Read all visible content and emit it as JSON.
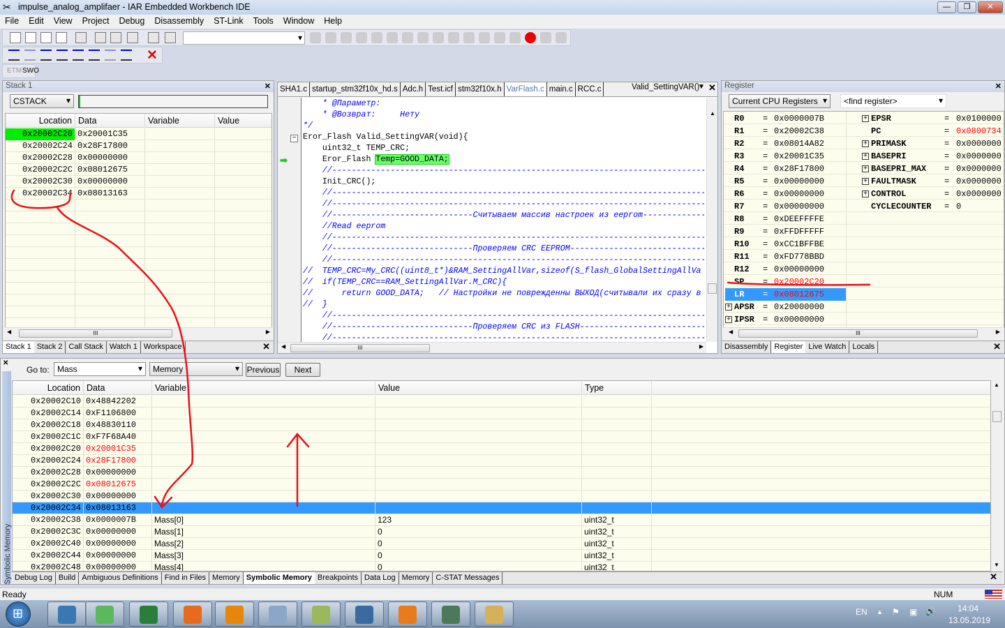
{
  "window": {
    "title": "impulse_analog_amplifaer - IAR Embedded Workbench IDE",
    "minimize": "—",
    "restore": "❐",
    "close": "✕"
  },
  "menu": [
    "File",
    "Edit",
    "View",
    "Project",
    "Debug",
    "Disassembly",
    "ST-Link",
    "Tools",
    "Window",
    "Help"
  ],
  "toolbar3": {
    "etm": "ETM",
    "swo": "SWO"
  },
  "stack_panel": {
    "title": "Stack 1",
    "combo": "CSTACK",
    "headers": [
      "Location",
      "Data",
      "Variable",
      "Value"
    ],
    "rows": [
      [
        "0x20002C20",
        "0x20001C35",
        "",
        ""
      ],
      [
        "0x20002C24",
        "0x28F17800",
        "",
        ""
      ],
      [
        "0x20002C28",
        "0x00000000",
        "",
        ""
      ],
      [
        "0x20002C2C",
        "0x08012675",
        "",
        ""
      ],
      [
        "0x20002C30",
        "0x00000000",
        "",
        ""
      ],
      [
        "0x20002C34",
        "0x08013163",
        "",
        ""
      ]
    ],
    "tabs": [
      "Stack 1",
      "Stack 2",
      "Call Stack",
      "Watch 1",
      "Workspace"
    ],
    "active_tab": 0
  },
  "editor": {
    "tabs": [
      "SHA1.c",
      "startup_stm32f10x_hd.s",
      "Adc.h",
      "Test.icf",
      "stm32f10x.h",
      "VarFlash.c",
      "main.c",
      "RCC.c"
    ],
    "active_tab": 5,
    "function_combo": "Valid_SettingVAR()",
    "lines": [
      {
        "t": "    * @Параметр:",
        "c": 1
      },
      {
        "t": "    * @Возврат:     Нету",
        "c": 1
      },
      {
        "t": "*/",
        "c": 1
      },
      {
        "t": "Eror_Flash Valid_SettingVAR(void){",
        "c": 0
      },
      {
        "t": "    uint32_t TEMP_CRC;",
        "c": 0
      },
      {
        "t": "    Eror_Flash ",
        "c": 0,
        "hl": "Temp=GOOD_DATA;"
      },
      {
        "t": "    //----------------------------------------------------------------------------------------",
        "c": 1
      },
      {
        "t": "    Init_CRC();",
        "c": 0
      },
      {
        "t": "    //----------------------------------------------------------------------------------------",
        "c": 1
      },
      {
        "t": "    //----------------------------------------------------------------------------------------",
        "c": 1
      },
      {
        "t": "    //-----------------------------Считываем массив настроек из eeprom---------------------------",
        "c": 1
      },
      {
        "t": "    //Read eeprom",
        "c": 1
      },
      {
        "t": "    //----------------------------------------------------------------------------------------",
        "c": 1
      },
      {
        "t": "    //-----------------------------Проверяем CRC EEPROM-------------------------------------------",
        "c": 1
      },
      {
        "t": "    //----------------------------------------------------------------------------------------",
        "c": 1
      },
      {
        "t": "//  TEMP_CRC=My_CRC((uint8_t*)&RAM_SettingAllVar,sizeof(S_flash_GlobalSettingAllVa",
        "c": 1
      },
      {
        "t": "//  if(TEMP_CRC==RAM_SettingAllVar.M_CRC){",
        "c": 1
      },
      {
        "t": "//      return GOOD_DATA;   // Настройки не поврежденны ВЫХОД(считывали их сразу в",
        "c": 1
      },
      {
        "t": "//  }",
        "c": 1
      },
      {
        "t": "    //----------------------------------------------------------------------------------------",
        "c": 1
      },
      {
        "t": "    //-----------------------------Проверяем CRC из FLASH-----------------------------------------",
        "c": 1
      },
      {
        "t": "    //----------------------------------------------------------------------------------------",
        "c": 1
      }
    ]
  },
  "register": {
    "title": "Register",
    "group_combo": "Current CPU Registers",
    "find_placeholder": "<find register>",
    "left": [
      [
        "R0",
        "0x0000007B",
        0,
        0
      ],
      [
        "R1",
        "0x20002C38",
        0,
        0
      ],
      [
        "R2",
        "0x08014A82",
        0,
        0
      ],
      [
        "R3",
        "0x20001C35",
        0,
        0
      ],
      [
        "R4",
        "0x28F17800",
        0,
        0
      ],
      [
        "R5",
        "0x00000000",
        0,
        0
      ],
      [
        "R6",
        "0x00000000",
        0,
        0
      ],
      [
        "R7",
        "0x00000000",
        0,
        0
      ],
      [
        "R8",
        "0xDEEFFFFE",
        0,
        0
      ],
      [
        "R9",
        "0xFFDFFFFF",
        0,
        0
      ],
      [
        "R10",
        "0xCC1BFFBE",
        0,
        0
      ],
      [
        "R11",
        "0xFD778BBD",
        0,
        0
      ],
      [
        "R12",
        "0x00000000",
        0,
        0
      ],
      [
        "SP",
        "0x20002C20",
        0,
        1
      ],
      [
        "LR",
        "0x08012675",
        0,
        1
      ],
      [
        "APSR",
        "0x20000000",
        1,
        0
      ],
      [
        "IPSR",
        "0x00000000",
        1,
        0
      ]
    ],
    "right": [
      [
        "EPSR",
        "0x0100000",
        1,
        0
      ],
      [
        "PC",
        "0x0800734",
        0,
        1
      ],
      [
        "PRIMASK",
        "0x0000000",
        1,
        0
      ],
      [
        "BASEPRI",
        "0x0000000",
        1,
        0
      ],
      [
        "BASEPRI_MAX",
        "0x0000000",
        1,
        0
      ],
      [
        "FAULTMASK",
        "0x0000000",
        1,
        0
      ],
      [
        "CONTROL",
        "0x0000000",
        1,
        0
      ],
      [
        "CYCLECOUNTER",
        "0",
        0,
        0
      ]
    ],
    "selected": "LR",
    "tabs": [
      "Disassembly",
      "Register",
      "Live Watch",
      "Locals"
    ],
    "active_tab": 1
  },
  "memory": {
    "goto_label": "Go to:",
    "goto_value": "Mass",
    "memory_combo": "Memory",
    "previous": "Previous",
    "next": "Next",
    "side_label": "Symbolic Memory",
    "headers": [
      "Location",
      "Data",
      "Variable",
      "Value",
      "Type"
    ],
    "rows": [
      [
        "0x20002C10",
        "0x48842202",
        "",
        "",
        ""
      ],
      [
        "0x20002C14",
        "0xF1106800",
        "",
        "",
        ""
      ],
      [
        "0x20002C18",
        "0x48830110",
        "",
        "",
        ""
      ],
      [
        "0x20002C1C",
        "0xF7F68A40",
        "",
        "",
        ""
      ],
      [
        "0x20002C20",
        "0x20001C35",
        "",
        "",
        ""
      ],
      [
        "0x20002C24",
        "0x28F17800",
        "",
        "",
        ""
      ],
      [
        "0x20002C28",
        "0x00000000",
        "",
        "",
        ""
      ],
      [
        "0x20002C2C",
        "0x08012675",
        "",
        "",
        ""
      ],
      [
        "0x20002C30",
        "0x00000000",
        "",
        "",
        ""
      ],
      [
        "0x20002C34",
        "0x08013163",
        "",
        "",
        ""
      ],
      [
        "0x20002C38",
        "0x0000007B",
        "Mass[0]",
        "123",
        "uint32_t"
      ],
      [
        "0x20002C3C",
        "0x00000000",
        "Mass[1]",
        "0",
        "uint32_t"
      ],
      [
        "0x20002C40",
        "0x00000000",
        "Mass[2]",
        "0",
        "uint32_t"
      ],
      [
        "0x20002C44",
        "0x00000000",
        "Mass[3]",
        "0",
        "uint32_t"
      ],
      [
        "0x20002C48",
        "0x00000000",
        "Mass[4]",
        "0",
        "uint32_t"
      ]
    ],
    "changed_rows": [
      4,
      5,
      7
    ],
    "selected_row": 9,
    "tabs": [
      "Debug Log",
      "Build",
      "Ambiguous Definitions",
      "Find in Files",
      "Memory",
      "Symbolic Memory",
      "Breakpoints",
      "Data Log",
      "Memory",
      "C-STAT Messages"
    ],
    "active_tab": 5
  },
  "status": {
    "text": "Ready",
    "num": "NUM"
  },
  "taskbar": {
    "lang": "EN",
    "time": "14:04",
    "date": "13.05.2019"
  },
  "colors": {
    "changed": "#ff0000",
    "selection": "#3399ff",
    "stack_top": "#00ee00",
    "annotation": "#e8101a",
    "code_highlight": "#66ff66",
    "comment": "#0000ff"
  }
}
